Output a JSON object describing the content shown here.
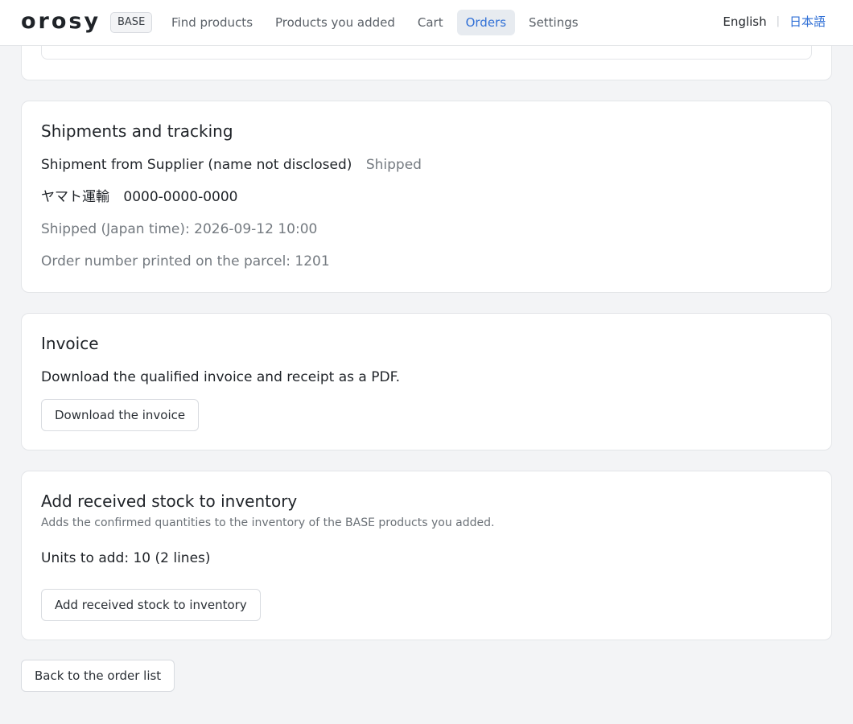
{
  "header": {
    "logo": "orosy",
    "badge": "BASE",
    "nav": [
      "Find products",
      "Products you added",
      "Cart",
      "Orders",
      "Settings"
    ],
    "active_nav": "Orders",
    "lang_en": "English",
    "lang_ja": "日本語"
  },
  "shipments": {
    "title": "Shipments and tracking",
    "from_label": "Shipment from Supplier (name not disclosed)",
    "status": "Shipped",
    "carrier": "ヤマト運輸",
    "tracking_number": "0000-0000-0000",
    "shipped_time": "Shipped (Japan time): 2026-09-12 10:00",
    "parcel_order_number": "Order number printed on the parcel: 1201"
  },
  "invoice": {
    "title": "Invoice",
    "description": "Download the qualified invoice and receipt as a PDF.",
    "button": "Download the invoice"
  },
  "stock": {
    "title": "Add received stock to inventory",
    "subtitle": "Adds the confirmed quantities to the inventory of the BASE products you added.",
    "units": "Units to add: 10 (2 lines)",
    "button": "Add received stock to inventory"
  },
  "back_button": "Back to the order list",
  "colors": {
    "accent": "#2f6fd6",
    "background": "#f3f4f6",
    "card": "#ffffff"
  }
}
